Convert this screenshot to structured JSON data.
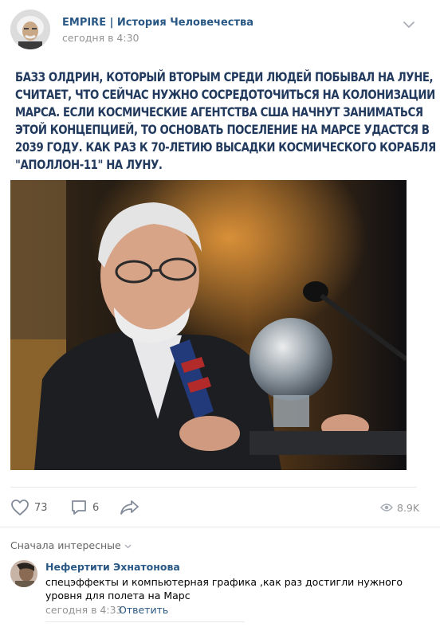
{
  "post": {
    "group_name": "EMPIRE | История Человечества",
    "time": "сегодня в 4:30",
    "text_lines": [
      "Базз Олдрин, который вторым среди людей побывал на Луне,",
      "считает, что сейчас нужно сосредоточиться на колонизации",
      "Марса. Если космические агентства США начнут заниматься",
      "этой концепцией, то основать поселение на Марсе удастся в",
      "2039 году. Как раз к 70-летию высадки космического корабля",
      "\"Аполлон-11\" на Луну."
    ]
  },
  "actions": {
    "likes": "73",
    "comments": "6",
    "views": "8.9K"
  },
  "icons": {
    "more": "chevron-down-icon",
    "like": "heart-icon",
    "comment": "comment-icon",
    "share": "share-arrow-icon",
    "views": "eye-icon"
  },
  "comments_section": {
    "sort_label": "Сначала интересные",
    "items": [
      {
        "author": "Нефертити Эхнатонова",
        "text": "спецэффекты и компьютерная графика ,как раз достигли нужного уровня для полета на Марс",
        "time": "сегодня в 4:33",
        "reply_label": "Ответить"
      }
    ]
  },
  "colors": {
    "link": "#2a5885",
    "meta": "#939393",
    "headline": "#223a5e",
    "divider": "#e7e8ec"
  }
}
